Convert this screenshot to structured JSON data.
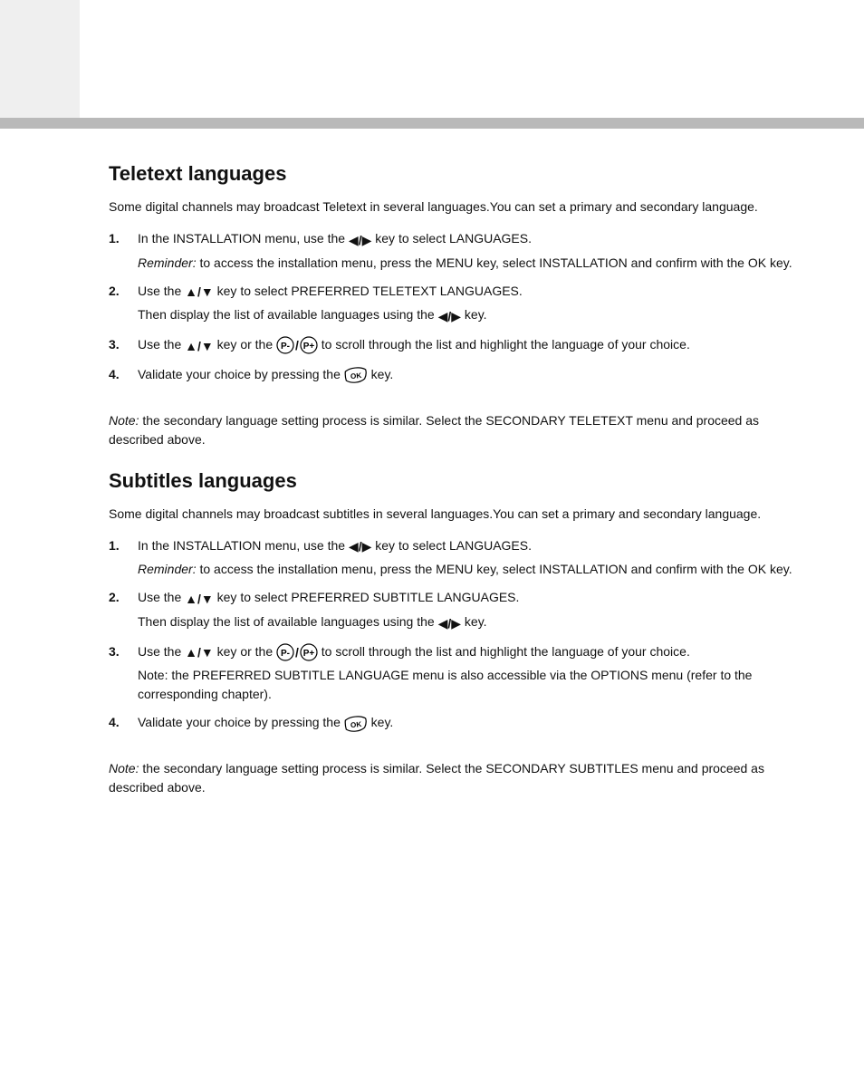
{
  "teletext": {
    "heading": "Teletext languages",
    "lead": "Some digital channels may broadcast Teletext in several languages.You can set a primary and secondary language.",
    "steps": [
      {
        "num": "1.",
        "a": "In the INSTALLATION menu, use the ",
        "b": " key to select LANGUAGES.",
        "sub_lead": "Reminder:",
        "sub": " to access the installation menu, press the MENU key, select INSTALLATION and confirm with the OK key."
      },
      {
        "num": "2.",
        "a": "Use the ",
        "b": " key to select PREFERRED TELETEXT LANGUAGES.",
        "c": "Then display the list of available languages using the ",
        "d": " key."
      },
      {
        "num": "3.",
        "a": "Use the ",
        "b": " key or the ",
        "c": " to scroll through the list and highlight the language of your choice."
      },
      {
        "num": "4.",
        "a": "Validate your choice by pressing the ",
        "b": " key."
      }
    ],
    "note_lead": "Note:",
    "note_text": " the secondary language setting process is similar. Select the SECONDARY TELETEXT menu and proceed as described above."
  },
  "subtitles": {
    "heading": "Subtitles languages",
    "lead": "Some digital channels may broadcast subtitles in several languages.You can set a primary and secondary language.",
    "steps": [
      {
        "num": "1.",
        "a": "In the INSTALLATION menu, use the ",
        "b": " key to select LANGUAGES.",
        "sub_lead": "Reminder:",
        "sub": " to access the installation menu, press the MENU key, select INSTALLATION and confirm with the OK key."
      },
      {
        "num": "2.",
        "a": "Use the ",
        "b": " key to select PREFERRED SUBTITLE LANGUAGES.",
        "c": "Then display the list of available languages using the ",
        "d": " key."
      },
      {
        "num": "3.",
        "a": "Use the ",
        "b": " key or the ",
        "c": " to scroll through the list and highlight the language of your choice.",
        "d": "Note: the PREFERRED SUBTITLE LANGUAGE menu is also accessible via the OPTIONS menu (refer to the corresponding chapter)."
      },
      {
        "num": "4.",
        "a": "Validate your choice by pressing the ",
        "b": " key."
      }
    ],
    "note_lead": "Note:",
    "note_text": " the secondary language setting process is similar. Select the SECONDARY SUBTITLES menu and proceed as described above."
  }
}
